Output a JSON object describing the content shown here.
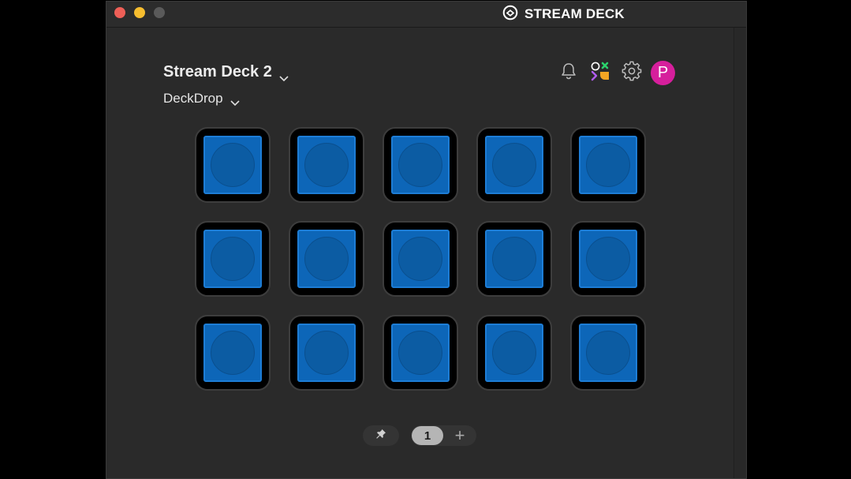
{
  "window": {
    "app_title": "STREAM DECK"
  },
  "device": {
    "name": "Stream Deck 2",
    "profile": "DeckDrop"
  },
  "header_icons": [
    "bell-icon",
    "marketplace-icon",
    "gear-icon",
    "avatar"
  ],
  "avatar": {
    "initial": "P",
    "color": "#d61f9c"
  },
  "keys": {
    "rows": 3,
    "columns": 5,
    "face_color": "#0d66b8"
  },
  "pager": {
    "current_page": "1",
    "add_label": "+"
  }
}
